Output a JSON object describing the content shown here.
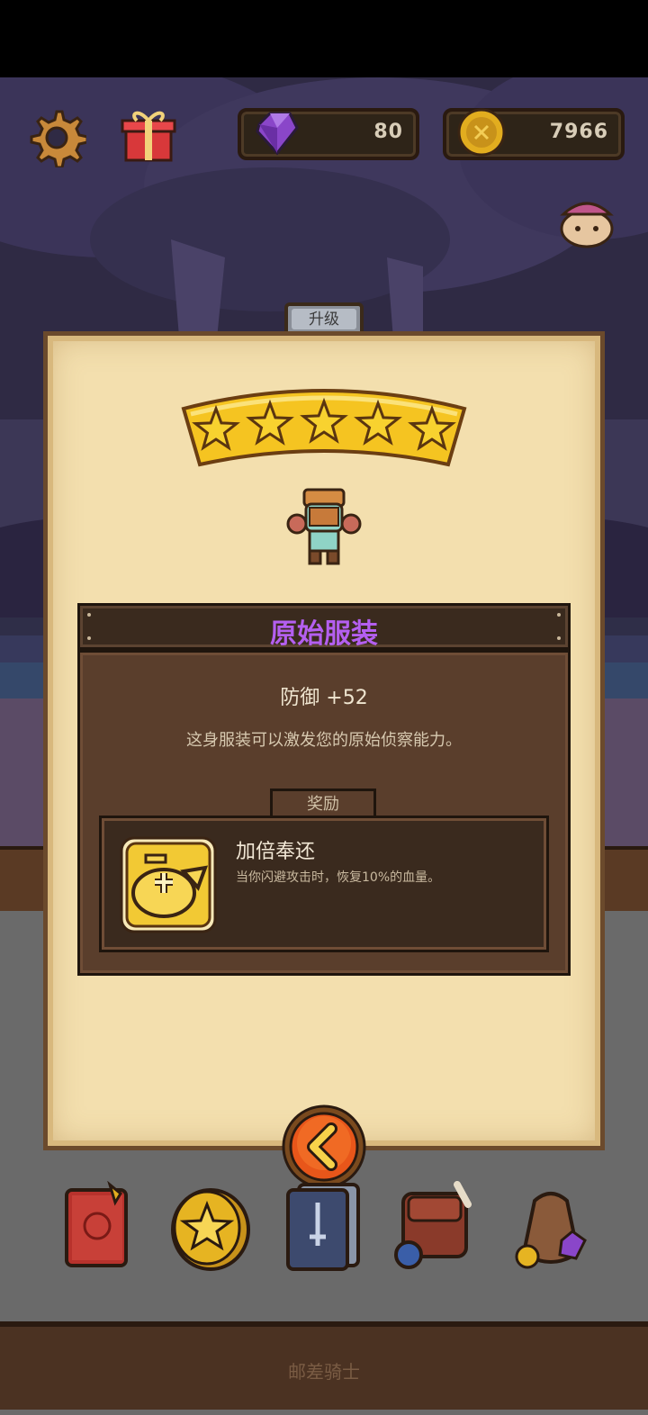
{
  "hud": {
    "gems": "80",
    "coins": "7966",
    "icons": [
      "gear-icon",
      "gift-icon",
      "gem-icon",
      "coin-icon"
    ]
  },
  "modal": {
    "tab_label": "升级",
    "stars": 5,
    "item_name": "原始服装",
    "stat": "防御 +52",
    "description": "这身服装可以激发您的原始侦察能力。",
    "reward_tab": "奖励",
    "reward": {
      "title": "加倍奉还",
      "description": "当你闪避攻击时，恢复10%的血量。"
    }
  },
  "colors": {
    "item_name": "#b45ff0",
    "parchment": "#f3dfae",
    "panel_brown": "#5a3e2c",
    "star_gold": "#f5c421",
    "back_button": "#e8561a"
  },
  "bottom_nav": {
    "icons": [
      "book-icon",
      "star-coin-icon",
      "cards-icon",
      "backpack-icon",
      "loot-bag-icon"
    ],
    "footer_label": "邮差骑士"
  }
}
